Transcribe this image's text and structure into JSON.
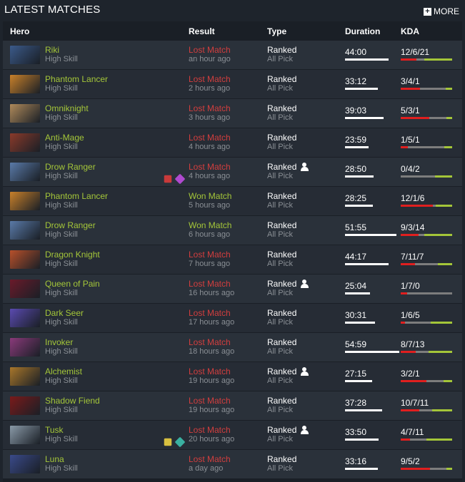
{
  "header": {
    "title": "LATEST MATCHES",
    "more_label": "MORE"
  },
  "columns": {
    "hero": "Hero",
    "result": "Result",
    "type": "Type",
    "duration": "Duration",
    "kda": "KDA"
  },
  "colors": {
    "won": "#a4c639",
    "lost": "#d33e3e",
    "kills": "#e01f1f",
    "deaths": "#7d7d7d",
    "assists": "#a4c639"
  },
  "matches": [
    {
      "hero": "Riki",
      "skill": "High Skill",
      "result": "Lost Match",
      "outcome": "lost",
      "ago": "an hour ago",
      "type": "Ranked",
      "mode": "All Pick",
      "party": false,
      "duration": "44:00",
      "minutes": 44.0,
      "kda": "12/6/21",
      "k": 12,
      "d": 6,
      "a": 21,
      "hero_color": "#3b5a8a",
      "items": []
    },
    {
      "hero": "Phantom Lancer",
      "skill": "High Skill",
      "result": "Lost Match",
      "outcome": "lost",
      "ago": "2 hours ago",
      "type": "Ranked",
      "mode": "All Pick",
      "party": false,
      "duration": "33:12",
      "minutes": 33.2,
      "kda": "3/4/1",
      "k": 3,
      "d": 4,
      "a": 1,
      "hero_color": "#c8802a",
      "items": []
    },
    {
      "hero": "Omniknight",
      "skill": "High Skill",
      "result": "Lost Match",
      "outcome": "lost",
      "ago": "3 hours ago",
      "type": "Ranked",
      "mode": "All Pick",
      "party": false,
      "duration": "39:03",
      "minutes": 39.05,
      "kda": "5/3/1",
      "k": 5,
      "d": 3,
      "a": 1,
      "hero_color": "#b08a5a",
      "items": []
    },
    {
      "hero": "Anti-Mage",
      "skill": "High Skill",
      "result": "Lost Match",
      "outcome": "lost",
      "ago": "4 hours ago",
      "type": "Ranked",
      "mode": "All Pick",
      "party": false,
      "duration": "23:59",
      "minutes": 23.98,
      "kda": "1/5/1",
      "k": 1,
      "d": 5,
      "a": 1,
      "hero_color": "#8a3a2a",
      "items": []
    },
    {
      "hero": "Drow Ranger",
      "skill": "High Skill",
      "result": "Lost Match",
      "outcome": "lost",
      "ago": "4 hours ago",
      "type": "Ranked",
      "mode": "All Pick",
      "party": true,
      "duration": "28:50",
      "minutes": 28.83,
      "kda": "0/4/2",
      "k": 0,
      "d": 4,
      "a": 2,
      "hero_color": "#5a7aa8",
      "items": [
        {
          "icon": "red-item-icon",
          "color": "#c83a3a"
        },
        {
          "icon": "purple-blade-icon",
          "color": "#b04ad0"
        }
      ]
    },
    {
      "hero": "Phantom Lancer",
      "skill": "High Skill",
      "result": "Won Match",
      "outcome": "won",
      "ago": "5 hours ago",
      "type": "Ranked",
      "mode": "All Pick",
      "party": false,
      "duration": "28:25",
      "minutes": 28.42,
      "kda": "12/1/6",
      "k": 12,
      "d": 1,
      "a": 6,
      "hero_color": "#c8802a",
      "items": []
    },
    {
      "hero": "Drow Ranger",
      "skill": "High Skill",
      "result": "Won Match",
      "outcome": "won",
      "ago": "6 hours ago",
      "type": "Ranked",
      "mode": "All Pick",
      "party": false,
      "duration": "51:55",
      "minutes": 51.92,
      "kda": "9/3/14",
      "k": 9,
      "d": 3,
      "a": 14,
      "hero_color": "#5a7aa8",
      "items": []
    },
    {
      "hero": "Dragon Knight",
      "skill": "High Skill",
      "result": "Lost Match",
      "outcome": "lost",
      "ago": "7 hours ago",
      "type": "Ranked",
      "mode": "All Pick",
      "party": false,
      "duration": "44:17",
      "minutes": 44.28,
      "kda": "7/11/7",
      "k": 7,
      "d": 11,
      "a": 7,
      "hero_color": "#b8502a",
      "items": []
    },
    {
      "hero": "Queen of Pain",
      "skill": "High Skill",
      "result": "Lost Match",
      "outcome": "lost",
      "ago": "16 hours ago",
      "type": "Ranked",
      "mode": "All Pick",
      "party": true,
      "duration": "25:04",
      "minutes": 25.07,
      "kda": "1/7/0",
      "k": 1,
      "d": 7,
      "a": 0,
      "hero_color": "#6a1a2a",
      "items": []
    },
    {
      "hero": "Dark Seer",
      "skill": "High Skill",
      "result": "Lost Match",
      "outcome": "lost",
      "ago": "17 hours ago",
      "type": "Ranked",
      "mode": "All Pick",
      "party": false,
      "duration": "30:31",
      "minutes": 30.52,
      "kda": "1/6/5",
      "k": 1,
      "d": 6,
      "a": 5,
      "hero_color": "#5a4ab0",
      "items": []
    },
    {
      "hero": "Invoker",
      "skill": "High Skill",
      "result": "Lost Match",
      "outcome": "lost",
      "ago": "18 hours ago",
      "type": "Ranked",
      "mode": "All Pick",
      "party": false,
      "duration": "54:59",
      "minutes": 54.98,
      "kda": "8/7/13",
      "k": 8,
      "d": 7,
      "a": 13,
      "hero_color": "#8a3a7a",
      "items": []
    },
    {
      "hero": "Alchemist",
      "skill": "High Skill",
      "result": "Lost Match",
      "outcome": "lost",
      "ago": "19 hours ago",
      "type": "Ranked",
      "mode": "All Pick",
      "party": true,
      "duration": "27:15",
      "minutes": 27.25,
      "kda": "3/2/1",
      "k": 3,
      "d": 2,
      "a": 1,
      "hero_color": "#a8762a",
      "items": []
    },
    {
      "hero": "Shadow Fiend",
      "skill": "High Skill",
      "result": "Lost Match",
      "outcome": "lost",
      "ago": "19 hours ago",
      "type": "Ranked",
      "mode": "All Pick",
      "party": false,
      "duration": "37:28",
      "minutes": 37.47,
      "kda": "10/7/11",
      "k": 10,
      "d": 7,
      "a": 11,
      "hero_color": "#7a1a1a",
      "items": []
    },
    {
      "hero": "Tusk",
      "skill": "High Skill",
      "result": "Lost Match",
      "outcome": "lost",
      "ago": "20 hours ago",
      "type": "Ranked",
      "mode": "All Pick",
      "party": true,
      "duration": "33:50",
      "minutes": 33.83,
      "kda": "4/7/11",
      "k": 4,
      "d": 7,
      "a": 11,
      "hero_color": "#8a9aa8",
      "items": [
        {
          "icon": "key-item-icon",
          "color": "#d8c040"
        },
        {
          "icon": "swap-item-icon",
          "color": "#3ab0a0"
        }
      ]
    },
    {
      "hero": "Luna",
      "skill": "High Skill",
      "result": "Lost Match",
      "outcome": "lost",
      "ago": "a day ago",
      "type": "Ranked",
      "mode": "All Pick",
      "party": false,
      "duration": "33:16",
      "minutes": 33.27,
      "kda": "9/5/2",
      "k": 9,
      "d": 5,
      "a": 2,
      "hero_color": "#3a4a8a",
      "items": []
    }
  ]
}
